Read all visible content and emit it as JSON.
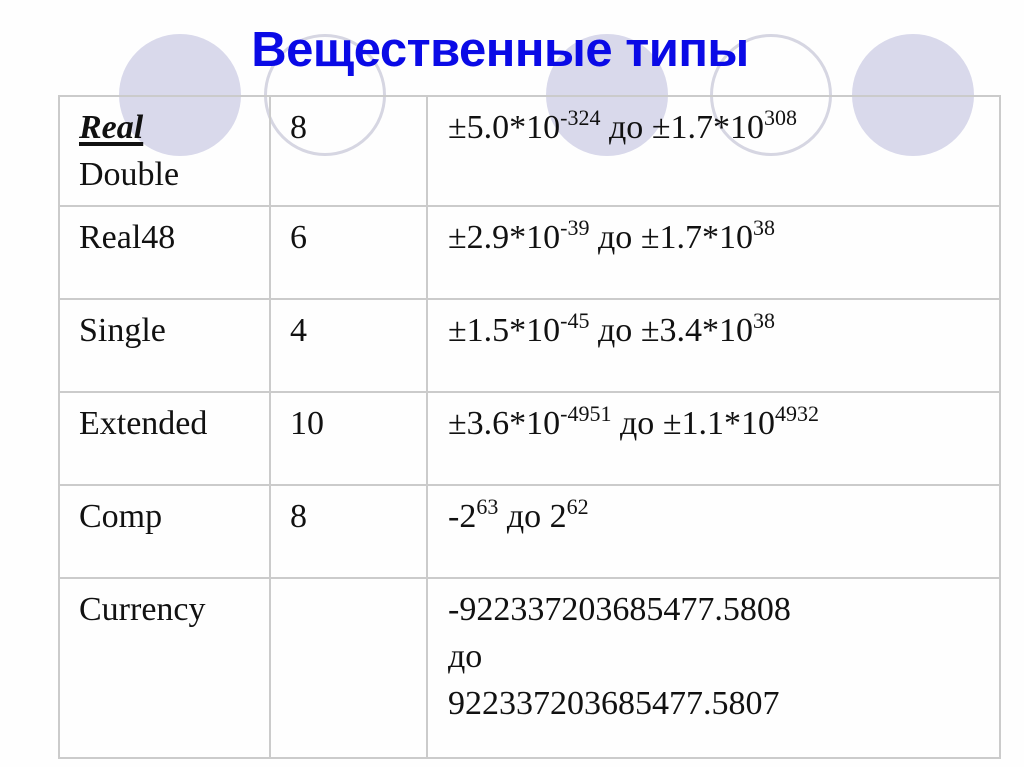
{
  "slide": {
    "title": "Вещественные типы",
    "decor": {
      "circles": [
        "filled",
        "outline",
        "filled",
        "outline",
        "filled"
      ],
      "circle_fill_color": "#d9d9eb",
      "circle_outline_color": "#d6d6e2",
      "title_color": "#0a0ae6"
    }
  },
  "table": {
    "rows": [
      {
        "name_primary": "Real",
        "name_secondary": "Double",
        "size": "8",
        "range": {
          "from_mantissa": "±5.0*10",
          "from_exp": "-324",
          "sep": " до ",
          "to_mantissa": "±1.7*10",
          "to_exp": "308"
        }
      },
      {
        "name_primary": "Real48",
        "size": "6",
        "range": {
          "from_mantissa": "±2.9*10",
          "from_exp": "-39",
          "sep": " до ",
          "to_mantissa": "±1.7*10",
          "to_exp": "38"
        }
      },
      {
        "name_primary": "Single",
        "size": "4",
        "range": {
          "from_mantissa": "±1.5*10",
          "from_exp": "-45",
          "sep": " до ",
          "to_mantissa": "±3.4*10",
          "to_exp": "38"
        }
      },
      {
        "name_primary": "Extended",
        "size": "10",
        "range": {
          "from_mantissa": "±3.6*10",
          "from_exp": "-4951",
          "sep": " до ",
          "to_mantissa": "±1.1*10",
          "to_exp": "4932"
        }
      },
      {
        "name_primary": "Comp",
        "size": "8",
        "range": {
          "from_mantissa": "-2",
          "from_exp": "63",
          "sep": " до ",
          "to_mantissa": "2",
          "to_exp": "62"
        }
      },
      {
        "name_primary": "Currency",
        "size": "",
        "range_lines": [
          "-922337203685477.5808",
          "до",
          "922337203685477.5807"
        ]
      }
    ]
  }
}
